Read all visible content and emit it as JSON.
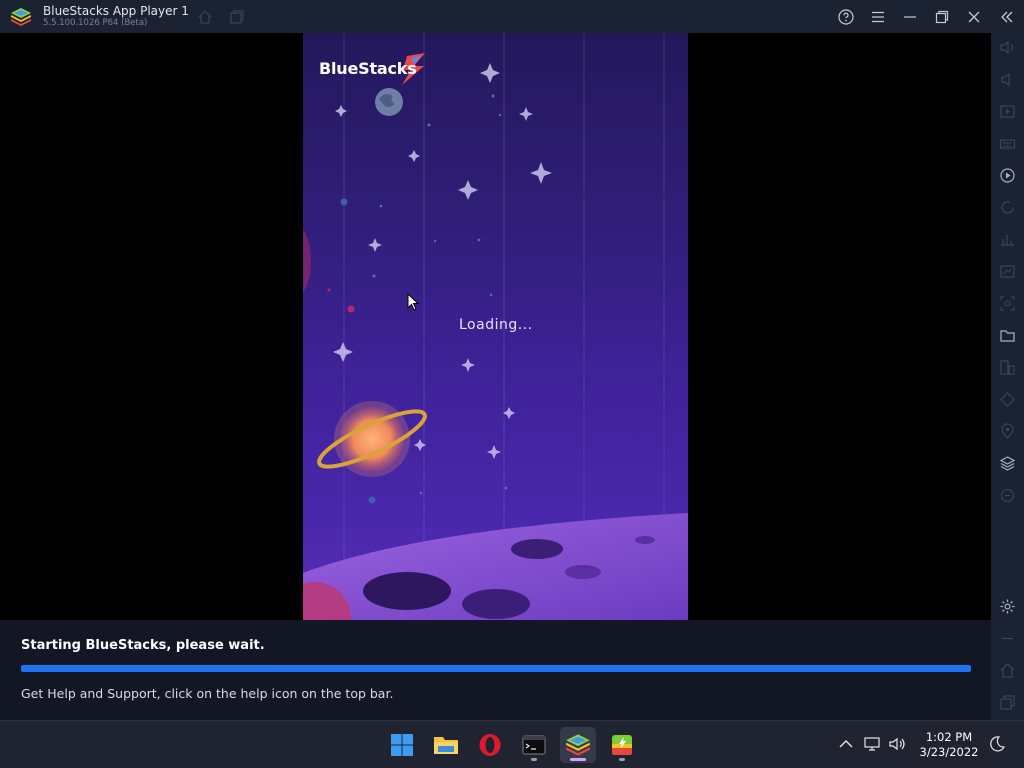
{
  "window": {
    "title": "BlueStacks App Player 1",
    "version": "5.5.100.1026 P64 (Beta)"
  },
  "screen": {
    "brand": "BlueStacks",
    "loading": "Loading..."
  },
  "status": {
    "title": "Starting BlueStacks, please wait.",
    "progress": 1.0,
    "help": "Get Help and Support, click on the help icon on the top bar."
  },
  "sidebar": {
    "icons": [
      "volume-up-icon",
      "volume-down-icon",
      "media-icon",
      "keyboard-icon",
      "record-play-icon",
      "rotate-icon",
      "performance-icon",
      "screen-size-icon",
      "screenshot-icon",
      "folder-icon",
      "multi-instance-icon",
      "eco-mode-icon",
      "location-icon",
      "layers-icon",
      "sync-icon",
      "settings-icon",
      "back-icon",
      "home-icon",
      "recent-apps-icon"
    ]
  },
  "taskbar": {
    "apps": [
      "windows-start-icon",
      "file-explorer-icon",
      "opera-icon",
      "terminal-icon",
      "bluestacks-icon",
      "bluestacks-x-icon"
    ],
    "time": "1:02 PM",
    "date": "3/23/2022"
  },
  "colors": {
    "titlebar": "#1b2232",
    "progress": "#1e74f0",
    "accent_purple": "#4b28ad"
  }
}
